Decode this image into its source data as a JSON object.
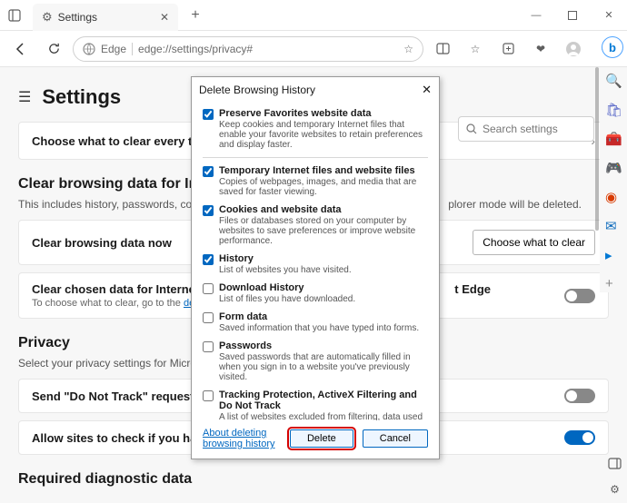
{
  "window": {
    "tab_label": "Settings",
    "url_protocol": "Edge",
    "url_path": "edge://settings/privacy#"
  },
  "header": {
    "title": "Settings",
    "search_placeholder": "Search settings"
  },
  "card_choose": "Choose what to clear every time you",
  "section_ie": {
    "title": "Clear browsing data for In",
    "desc_left": "This includes history, passwords, cooki",
    "desc_right": "plorer mode will be deleted.",
    "clear_now": "Clear browsing data now",
    "choose_btn": "Choose what to clear",
    "clear_chosen": "Clear chosen data for Internet Expl",
    "clear_chosen_right": "t Edge",
    "clear_chosen_sub_left": "To choose what to clear, go to the ",
    "clear_chosen_link": "delete"
  },
  "privacy": {
    "title": "Privacy",
    "desc": "Select your privacy settings for Micros",
    "dnt": "Send \"Do Not Track\" requests",
    "payment": "Allow sites to check if you have payment methods saved"
  },
  "diag": {
    "title": "Required diagnostic data"
  },
  "dialog": {
    "title": "Delete Browsing History",
    "items": [
      {
        "checked": true,
        "title": "Preserve Favorites website data",
        "desc": "Keep cookies and temporary Internet files that enable your favorite websites to retain preferences and display faster."
      },
      {
        "checked": true,
        "title": "Temporary Internet files and website files",
        "desc": "Copies of webpages, images, and media that are saved for faster viewing."
      },
      {
        "checked": true,
        "title": "Cookies and website data",
        "desc": "Files or databases stored on your computer by websites to save preferences or improve website performance."
      },
      {
        "checked": true,
        "title": "History",
        "desc": "List of websites you have visited."
      },
      {
        "checked": false,
        "title": "Download History",
        "desc": "List of files you have downloaded."
      },
      {
        "checked": false,
        "title": "Form data",
        "desc": "Saved information that you have typed into forms."
      },
      {
        "checked": false,
        "title": "Passwords",
        "desc": "Saved passwords that are automatically filled in when you sign in to a website you've previously visited."
      },
      {
        "checked": false,
        "title": "Tracking Protection, ActiveX Filtering and Do Not Track",
        "desc": "A list of websites excluded from filtering, data used by Tracking Protection to detect where sites might automatically be sharing details about your visit, and exceptions to Do Not Track requests."
      }
    ],
    "about_link": "About deleting browsing history",
    "delete": "Delete",
    "cancel": "Cancel"
  }
}
